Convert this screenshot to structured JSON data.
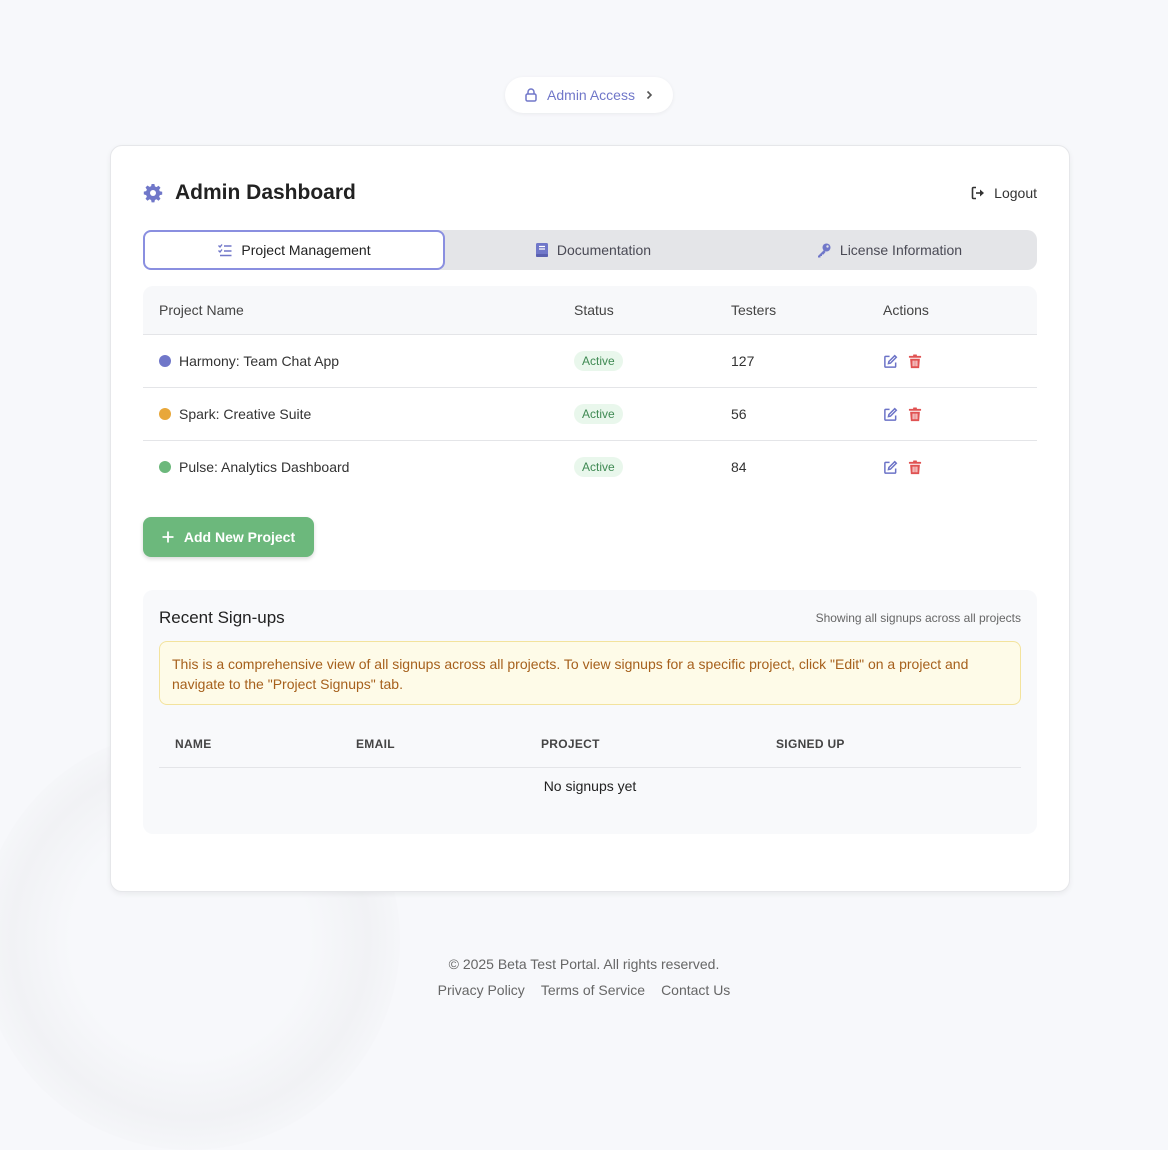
{
  "access_pill": {
    "label": "Admin Access"
  },
  "header": {
    "title": "Admin Dashboard",
    "logout_label": "Logout"
  },
  "tabs": [
    {
      "label": "Project Management",
      "icon": "checklist-icon",
      "active": true
    },
    {
      "label": "Documentation",
      "icon": "book-icon",
      "active": false
    },
    {
      "label": "License Information",
      "icon": "key-icon",
      "active": false
    }
  ],
  "projects_table": {
    "columns": [
      "Project Name",
      "Status",
      "Testers",
      "Actions"
    ],
    "rows": [
      {
        "name": "Harmony: Team Chat App",
        "dot_color": "#7077c9",
        "status": "Active",
        "testers": "127"
      },
      {
        "name": "Spark: Creative Suite",
        "dot_color": "#e8a73a",
        "status": "Active",
        "testers": "56"
      },
      {
        "name": "Pulse: Analytics Dashboard",
        "dot_color": "#6cb87c",
        "status": "Active",
        "testers": "84"
      }
    ]
  },
  "add_button": {
    "label": "Add New Project"
  },
  "signups": {
    "title": "Recent Sign-ups",
    "note": "Showing all signups across all projects",
    "info": "This is a comprehensive view of all signups across all projects. To view signups for a specific project, click \"Edit\" on a project and navigate to the \"Project Signups\" tab.",
    "columns": [
      "NAME",
      "EMAIL",
      "PROJECT",
      "SIGNED UP"
    ],
    "empty_message": "No signups yet"
  },
  "footer": {
    "copyright": "© 2025 Beta Test Portal. All rights reserved.",
    "links": [
      "Privacy Policy",
      "Terms of Service",
      "Contact Us"
    ]
  },
  "colors": {
    "accent": "#7077c9",
    "success": "#6cb87c",
    "danger": "#e05252",
    "warning_text": "#a6601c"
  }
}
